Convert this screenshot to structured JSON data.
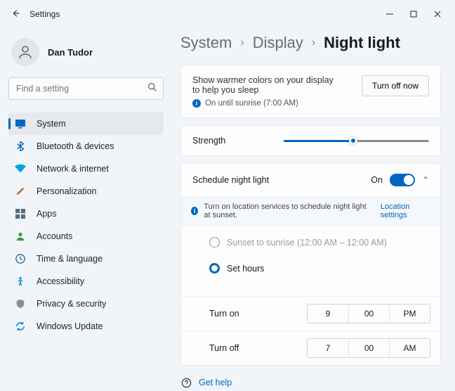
{
  "window": {
    "title": "Settings"
  },
  "user": {
    "name": "Dan Tudor"
  },
  "search": {
    "placeholder": "Find a setting"
  },
  "sidebar": {
    "items": [
      {
        "label": "System",
        "icon": "system-icon",
        "color": "#0067c0",
        "active": true
      },
      {
        "label": "Bluetooth & devices",
        "icon": "bluetooth-icon",
        "color": "#0067c0"
      },
      {
        "label": "Network & internet",
        "icon": "wifi-icon",
        "color": "#00a6de"
      },
      {
        "label": "Personalization",
        "icon": "brush-icon",
        "color": "#c06a2a"
      },
      {
        "label": "Apps",
        "icon": "apps-icon",
        "color": "#5a6b7b"
      },
      {
        "label": "Accounts",
        "icon": "accounts-icon",
        "color": "#2e9b4f"
      },
      {
        "label": "Time & language",
        "icon": "clock-icon",
        "color": "#3a6a9a"
      },
      {
        "label": "Accessibility",
        "icon": "accessibility-icon",
        "color": "#0a8ad6"
      },
      {
        "label": "Privacy & security",
        "icon": "shield-icon",
        "color": "#8a8f94"
      },
      {
        "label": "Windows Update",
        "icon": "update-icon",
        "color": "#0a8ad6"
      }
    ]
  },
  "breadcrumb": {
    "a": "System",
    "b": "Display",
    "c": "Night light"
  },
  "night_light": {
    "description": "Show warmer colors on your display to help you sleep",
    "status": "On until sunrise (7:00 AM)",
    "button": "Turn off now",
    "strength_label": "Strength",
    "strength_value": 48,
    "schedule_label": "Schedule night light",
    "schedule_state": "On",
    "banner_text": "Turn on location services to schedule night light at sunset.",
    "banner_link": "Location settings",
    "option_sunset": "Sunset to sunrise (12:00 AM – 12:00 AM)",
    "option_sethours": "Set hours",
    "turn_on": {
      "label": "Turn on",
      "h": "9",
      "m": "00",
      "p": "PM"
    },
    "turn_off": {
      "label": "Turn off",
      "h": "7",
      "m": "00",
      "p": "AM"
    }
  },
  "help": {
    "label": "Get help"
  }
}
